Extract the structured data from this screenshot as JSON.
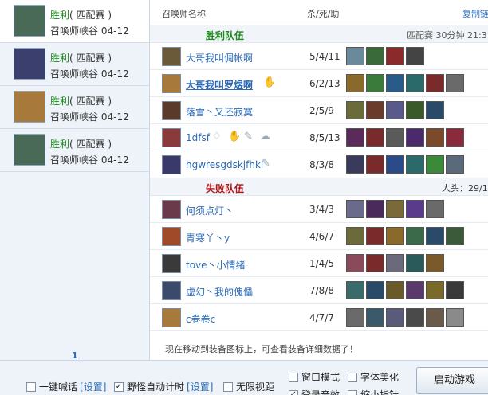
{
  "matches": [
    {
      "result": "胜利",
      "mode": "( 匹配赛 )",
      "map": "召唤师峡谷",
      "date": "04-12",
      "color": "#4a6a58"
    },
    {
      "result": "胜利",
      "mode": "( 匹配赛 )",
      "map": "召唤师峡谷",
      "date": "04-12",
      "color": "#3a3f6e"
    },
    {
      "result": "胜利",
      "mode": "( 匹配赛 )",
      "map": "召唤师峡谷",
      "date": "04-12",
      "color": "#a77a3c"
    },
    {
      "result": "胜利",
      "mode": "( 匹配赛 )",
      "map": "召唤师峡谷",
      "date": "04-12",
      "color": "#4a6a58"
    }
  ],
  "page_number": "1",
  "table": {
    "col_name": "召唤师名称",
    "col_kda": "杀/死/助",
    "col_copy": "复制链"
  },
  "win_team": {
    "label": "胜利队伍",
    "meta": "匹配赛 30分钟 21:3",
    "players": [
      {
        "name": "大哥我叫倜帐啊",
        "kda": "5/4/11",
        "bold": false,
        "champ": "#6b5a3a",
        "items": [
          "#6a8a9a",
          "#3a6a3a",
          "#8a2a2a",
          "#444444"
        ]
      },
      {
        "name": "大哥我叫罗煜啊",
        "kda": "6/2/13",
        "bold": true,
        "champ": "#a77a3c",
        "items": [
          "#8a6a2a",
          "#3a7a3a",
          "#2a5a8a",
          "#2a6a6a",
          "#7a2a2a",
          "#6a6a6a"
        ]
      },
      {
        "name": "落雪丶又还寂寞",
        "kda": "2/5/9",
        "bold": false,
        "champ": "#5a3a2a",
        "items": [
          "#6a6a3a",
          "#6a3a2a",
          "#5a5a8a",
          "#3a5a2a",
          "#2a4a6a"
        ]
      },
      {
        "name": "1dfsf",
        "kda": "8/5/13",
        "bold": false,
        "champ": "#8a3a3a",
        "items": [
          "#5a2a5a",
          "#7a2a2a",
          "#5a5a5a",
          "#4a2a6a",
          "#7a4a2a",
          "#8a2a3a"
        ]
      },
      {
        "name": "hgwresgdskjfhkl",
        "kda": "8/3/8",
        "bold": false,
        "champ": "#3a3a6a",
        "items": [
          "#3a3a5a",
          "#7a2a2a",
          "#2a4a8a",
          "#2a6a6a",
          "#3a8a3a",
          "#5a6a7a"
        ]
      }
    ]
  },
  "lose_team": {
    "label": "失败队伍",
    "kills": "人头：29/1",
    "players": [
      {
        "name": "何须点灯丶",
        "kda": "3/4/3",
        "bold": false,
        "champ": "#6a3a4a",
        "items": [
          "#6a6a8a",
          "#4a2a5a",
          "#7a6a3a",
          "#5a3a8a",
          "#6a6a6a"
        ]
      },
      {
        "name": "青寒丫丶y",
        "kda": "4/6/7",
        "bold": false,
        "champ": "#a04a2a",
        "items": [
          "#6a6a3a",
          "#7a2a2a",
          "#8a6a2a",
          "#3a6a4a",
          "#2a4a6a",
          "#3a5a3a"
        ]
      },
      {
        "name": "tove丶小情绪",
        "kda": "1/4/5",
        "bold": false,
        "champ": "#3a3a3a",
        "items": [
          "#8a4a5a",
          "#7a2a2a",
          "#6a6a7a",
          "#2a5a5a",
          "#7a5a2a"
        ]
      },
      {
        "name": "虚幻丶我的傀儡",
        "kda": "7/8/8",
        "bold": false,
        "champ": "#3a4a6a",
        "items": [
          "#3a6a6a",
          "#2a4a6a",
          "#6a5a2a",
          "#5a3a6a",
          "#7a6a2a",
          "#3a3a3a"
        ]
      },
      {
        "name": "c卷卷c",
        "kda": "4/7/7",
        "bold": false,
        "champ": "#a77a3c",
        "items": [
          "#6a6a6a",
          "#3a5a6a",
          "#5a5a7a",
          "#4a4a4a",
          "#6a5a4a",
          "#8a8a8a"
        ]
      }
    ]
  },
  "footer_note": "现在移动到装备图标上，可查看装备详细数据了！",
  "bottom": {
    "opt1": "一键喊话",
    "opt1_link": "[设置]",
    "opt2": "野怪自动计时",
    "opt2_link": "[设置]",
    "opt3": "无限视距",
    "opt4": "窗口模式",
    "opt5": "字体美化",
    "opt6": "登录音效",
    "opt7": "缩小指针",
    "start": "启动游戏"
  }
}
